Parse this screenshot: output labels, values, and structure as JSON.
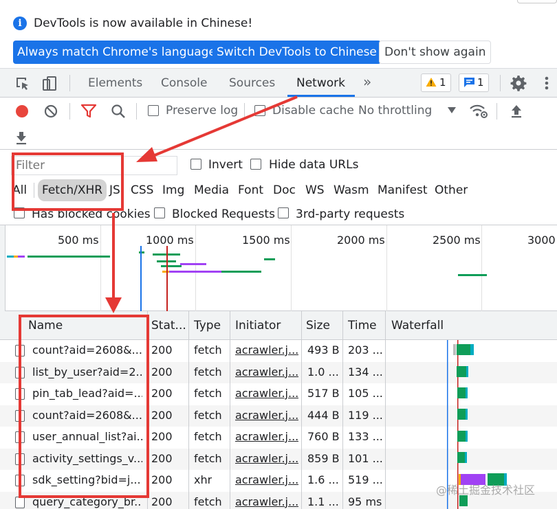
{
  "infobar": {
    "message": "DevTools is now available in Chinese!",
    "buttons": {
      "match_language": "Always match Chrome's language",
      "switch_chinese": "Switch DevTools to Chinese",
      "dont_show": "Don't show again"
    }
  },
  "tabs": {
    "elements": "Elements",
    "console": "Console",
    "sources": "Sources",
    "network": "Network",
    "more": "»",
    "active": "Network"
  },
  "badges": {
    "warnings": "1",
    "messages": "1"
  },
  "network_toolbar": {
    "preserve_log": "Preserve log",
    "disable_cache": "Disable cache",
    "throttling": "No throttling"
  },
  "filter": {
    "placeholder": "Filter",
    "invert": "Invert",
    "hide_data_urls": "Hide data URLs",
    "types": [
      "All",
      "Fetch/XHR",
      "JS",
      "CSS",
      "Img",
      "Media",
      "Font",
      "Doc",
      "WS",
      "Wasm",
      "Manifest",
      "Other"
    ],
    "active_type": "Fetch/XHR",
    "has_blocked_cookies": "Has blocked cookies",
    "blocked_requests": "Blocked Requests",
    "third_party": "3rd-party requests"
  },
  "overview": {
    "ticks": [
      "500 ms",
      "1000 ms",
      "1500 ms",
      "2000 ms",
      "2500 ms",
      "3000"
    ]
  },
  "table": {
    "headers": {
      "name": "Name",
      "status": "Stat...",
      "type": "Type",
      "initiator": "Initiator",
      "size": "Size",
      "time": "Time",
      "waterfall": "Waterfall"
    },
    "rows": [
      {
        "name": "count?aid=2608&...",
        "status": "200",
        "type": "fetch",
        "initiator": "acrawler.j...",
        "size": "493 B",
        "time": "203 ..."
      },
      {
        "name": "list_by_user?aid=2...",
        "status": "200",
        "type": "fetch",
        "initiator": "acrawler.j...",
        "size": "1.0 ...",
        "time": "134 ..."
      },
      {
        "name": "pin_tab_lead?aid=...",
        "status": "200",
        "type": "fetch",
        "initiator": "acrawler.j...",
        "size": "517 B",
        "time": "105 ..."
      },
      {
        "name": "count?aid=2608&...",
        "status": "200",
        "type": "fetch",
        "initiator": "acrawler.j...",
        "size": "444 B",
        "time": "119 ..."
      },
      {
        "name": "user_annual_list?ai...",
        "status": "200",
        "type": "fetch",
        "initiator": "acrawler.j...",
        "size": "760 B",
        "time": "133 ..."
      },
      {
        "name": "activity_settings_v...",
        "status": "200",
        "type": "fetch",
        "initiator": "acrawler.j...",
        "size": "859 B",
        "time": "101 ..."
      },
      {
        "name": "sdk_setting?bid=j...",
        "status": "200",
        "type": "xhr",
        "initiator": "acrawler.j...",
        "size": "1.6 ...",
        "time": "519 ..."
      },
      {
        "name": "query_category_br...",
        "status": "200",
        "type": "fetch",
        "initiator": "acrawler.j...",
        "size": "1.1 ...",
        "time": "95 ms"
      }
    ]
  },
  "watermark": "@稀土掘金技术社区",
  "colors": {
    "accent": "#1a73e8",
    "annotation": "#e53935",
    "record": "#e8453c",
    "warning": "#f9ab00",
    "waterfall_green": "#0f9d58",
    "waterfall_cyan": "#00acc1",
    "waterfall_purple": "#a142f4"
  }
}
